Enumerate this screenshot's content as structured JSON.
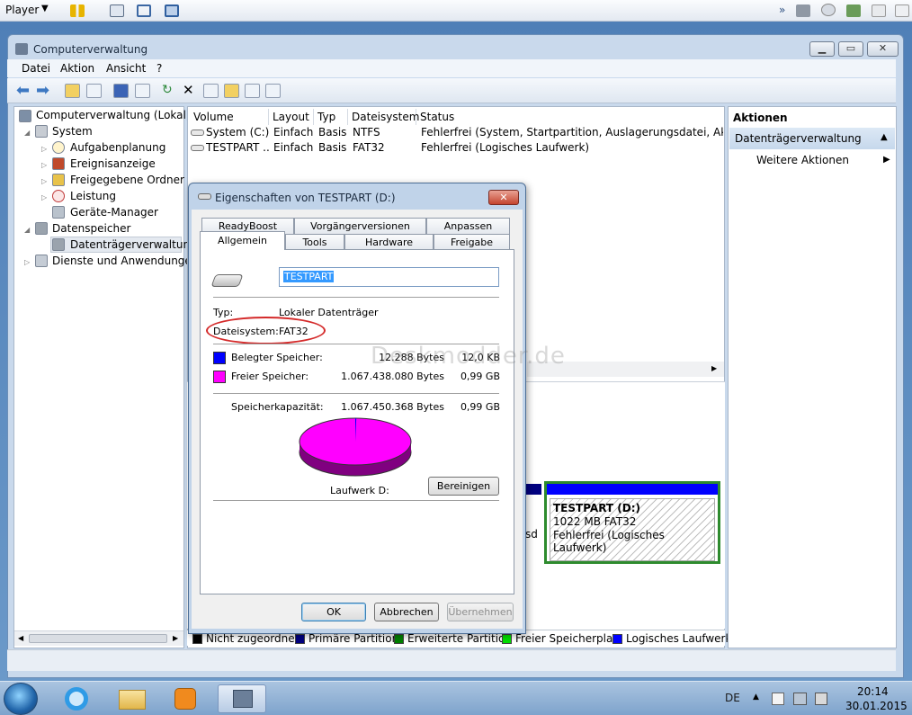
{
  "player": {
    "label": "Player"
  },
  "window": {
    "title": "Computerverwaltung"
  },
  "menu": [
    "Datei",
    "Aktion",
    "Ansicht",
    "?"
  ],
  "tree": {
    "root": "Computerverwaltung (Lokal)",
    "system": "System",
    "aufgaben": "Aufgabenplanung",
    "ereignis": "Ereignisanzeige",
    "freigabe": "Freigegebene Ordner",
    "leistung": "Leistung",
    "geraete": "Geräte-Manager",
    "speicher": "Datenspeicher",
    "dtv": "Datenträgerverwaltung",
    "dienste": "Dienste und Anwendungen"
  },
  "volumes": {
    "columns": [
      "Volume",
      "Layout",
      "Typ",
      "Dateisystem",
      "Status"
    ],
    "rows": [
      {
        "volume": "System (C:)",
        "layout": "Einfach",
        "typ": "Basis",
        "fs": "NTFS",
        "status": "Fehlerfrei (System, Startpartition, Auslagerungsdatei, Aktiv, Abst"
      },
      {
        "volume": "TESTPART ...",
        "layout": "Einfach",
        "typ": "Basis",
        "fs": "FAT32",
        "status": "Fehlerfrei (Logisches Laufwerk)"
      }
    ]
  },
  "partition": {
    "name": "TESTPART  (D:)",
    "size": "1022 MB FAT32",
    "status": "Fehlerfrei (Logisches Laufwerk)",
    "clip": "sd"
  },
  "legend": [
    "Nicht zugeordnet",
    "Primäre Partition",
    "Erweiterte Partition",
    "Freier Speicherplatz",
    "Logisches Laufwerk"
  ],
  "actions": {
    "header": "Aktionen",
    "section": "Datenträgerverwaltung",
    "more": "Weitere Aktionen"
  },
  "dialog": {
    "title": "Eigenschaften von TESTPART (D:)",
    "tabs_row1": [
      "ReadyBoost",
      "Vorgängerversionen",
      "Anpassen"
    ],
    "tabs_row2": [
      "Allgemein",
      "Tools",
      "Hardware",
      "Freigabe"
    ],
    "name_value": "TESTPART",
    "typ_label": "Typ:",
    "typ_value": "Lokaler Datenträger",
    "fs_label": "Dateisystem:",
    "fs_value": "FAT32",
    "used_label": "Belegter Speicher:",
    "used_bytes": "12.288 Bytes",
    "used_h": "12,0 KB",
    "free_label": "Freier Speicher:",
    "free_bytes": "1.067.438.080 Bytes",
    "free_h": "0,99 GB",
    "cap_label": "Speicherkapazität:",
    "cap_bytes": "1.067.450.368 Bytes",
    "cap_h": "0,99 GB",
    "drive_label": "Laufwerk D:",
    "cleanup": "Bereinigen",
    "ok": "OK",
    "cancel": "Abbrechen",
    "apply": "Übernehmen",
    "used_fraction": 1.15e-05,
    "colors": {
      "used": "#0000ff",
      "free": "#ff00ff"
    }
  },
  "watermark": "Deskmodder.de",
  "tray": {
    "lang": "DE",
    "time": "20:14",
    "date": "30.01.2015"
  }
}
